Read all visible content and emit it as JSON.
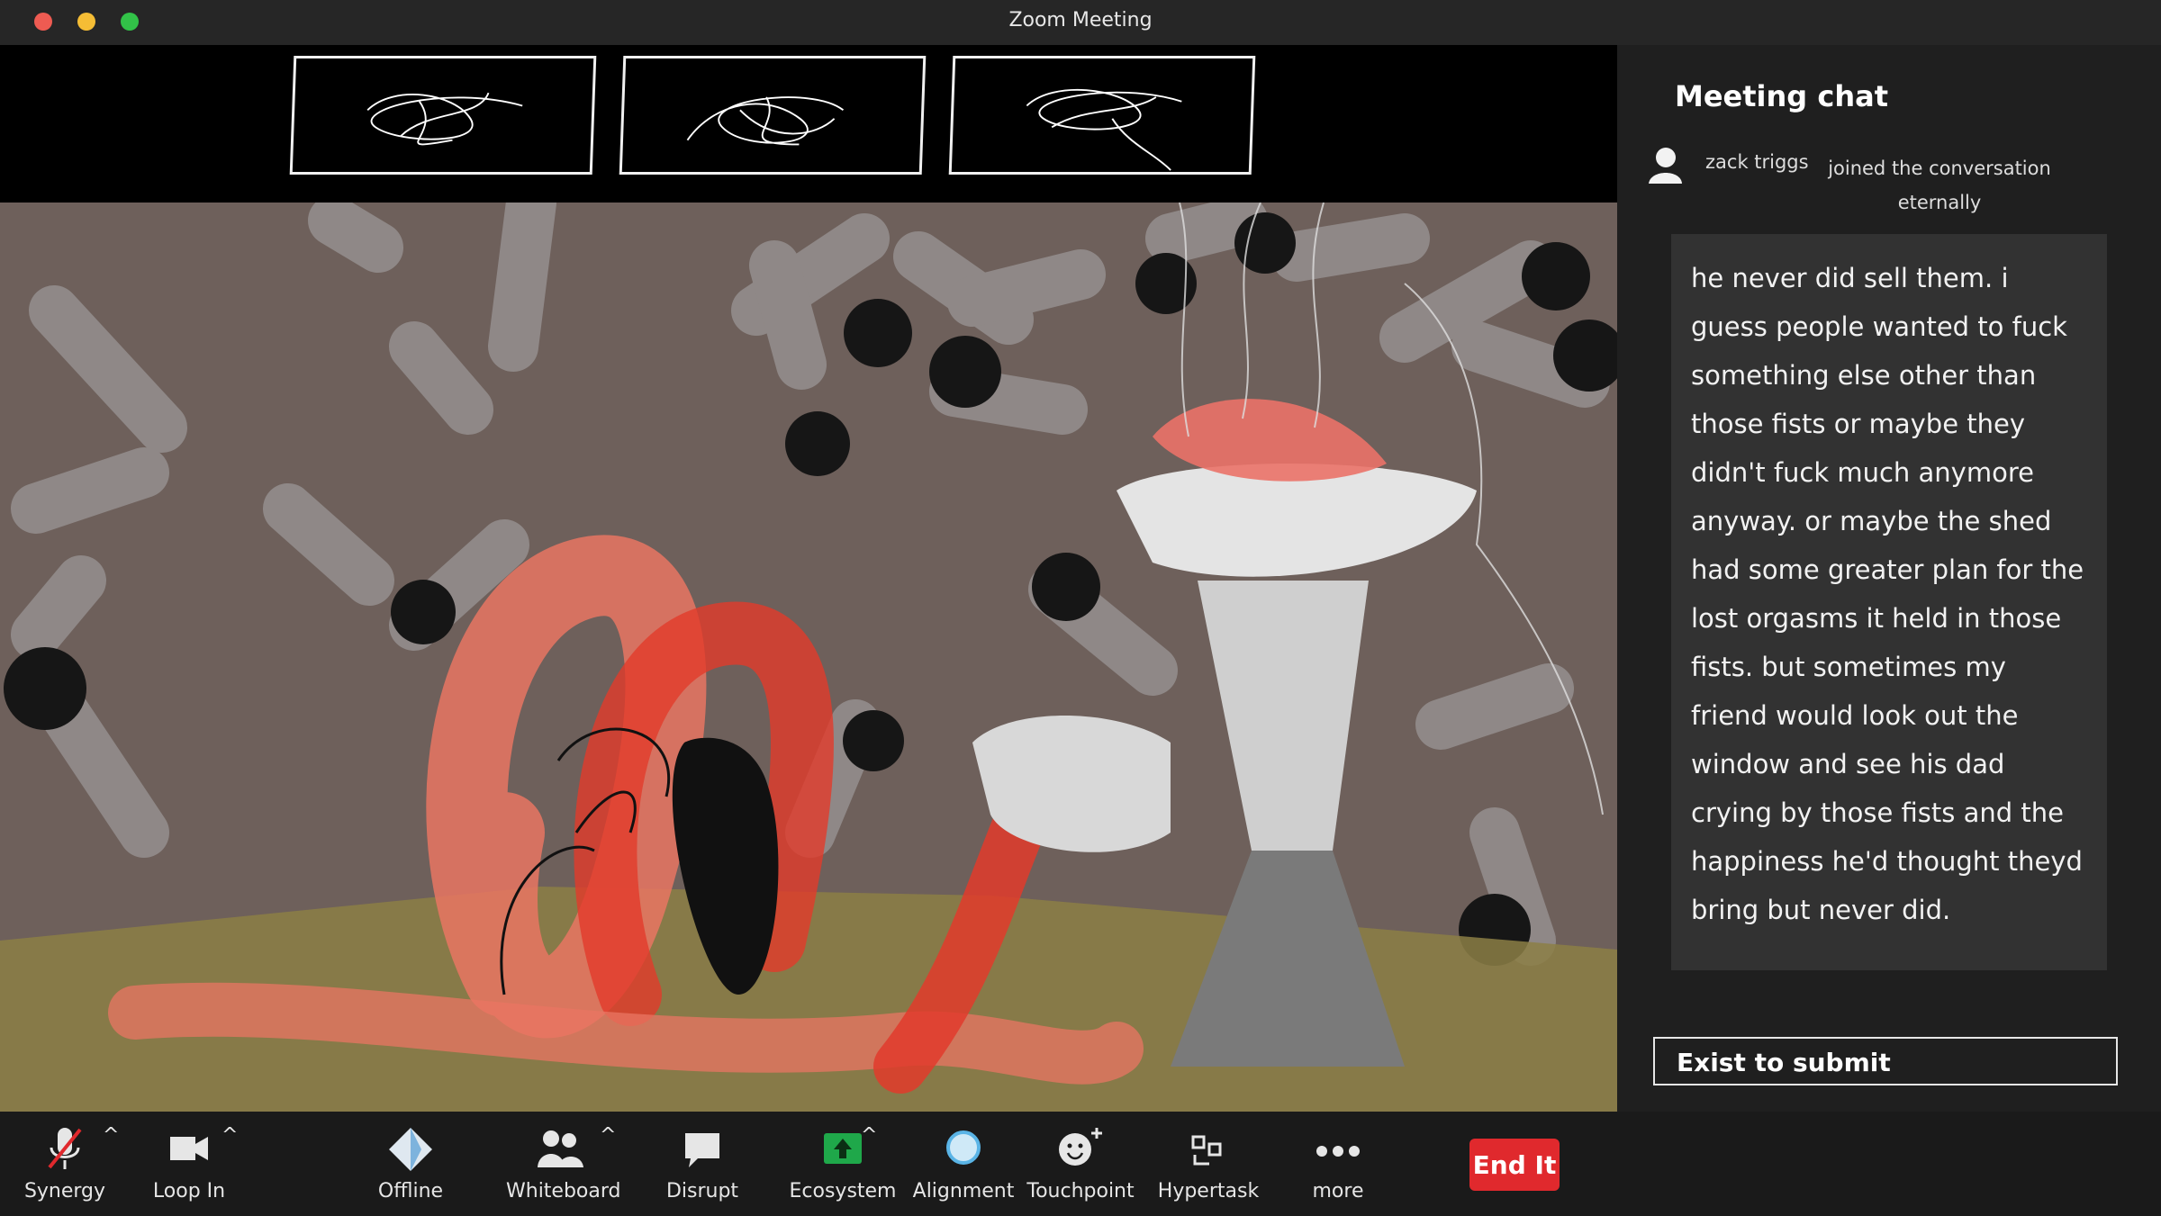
{
  "window": {
    "title": "Zoom Meeting"
  },
  "chat": {
    "title": "Meeting chat",
    "join_user": "zack triggs",
    "join_text": "joined the conversation eternally",
    "message": "he never did sell them. i guess people wanted to fuck something else other than those fists or maybe they didn't fuck much anymore anyway. or maybe the shed had some greater plan for the lost orgasms it held in those fists. but sometimes my friend would look out the window and see his dad crying by those fists and the happiness he'd thought theyd bring but never did.",
    "input_value": "Exist to submit"
  },
  "toolbar": {
    "synergy": "Synergy",
    "loop_in": "Loop In",
    "offline": "Offline",
    "whiteboard": "Whiteboard",
    "disrupt": "Disrupt",
    "ecosystem": "Ecosystem",
    "alignment": "Alignment",
    "touchpoint": "Touchpoint",
    "hypertask": "Hypertask",
    "more": "more",
    "end": "End It",
    "caret": "^"
  },
  "colors": {
    "end_button": "#e0292d",
    "ecosystem_icon": "#1fa84a",
    "alignment_icon": "#5ab4e6"
  }
}
